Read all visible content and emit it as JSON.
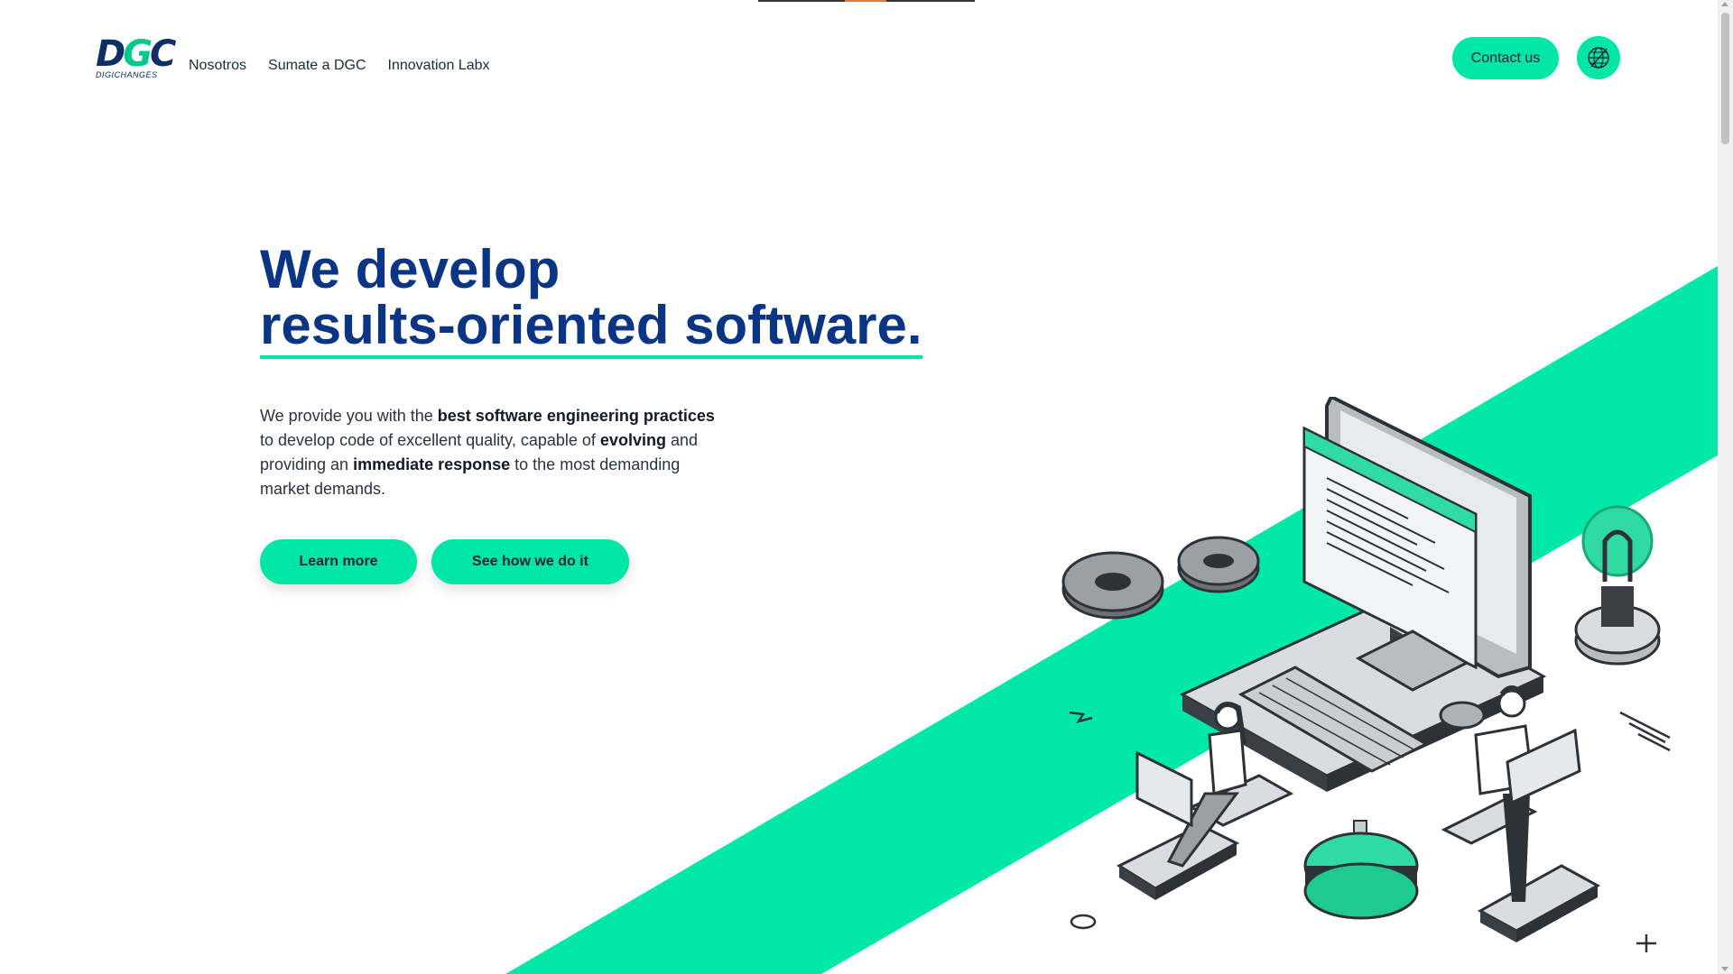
{
  "header": {
    "logo_text": "DGC",
    "logo_subtext": "DIGICHANGES",
    "nav": [
      "Nosotros",
      "Sumate a DGC",
      "Innovation Labx"
    ],
    "contact_label": "Contact us",
    "language_icon": "globe-icon"
  },
  "hero": {
    "title_line1": "We develop",
    "title_line2": "results-oriented software.",
    "desc": {
      "p1": "We provide you with the ",
      "b1": "best software engineering practices",
      "p2": " to develop code of excellent quality, capable of ",
      "b2": "evolving",
      "p3": " and providing an ",
      "b3": "immediate response",
      "p4": " to the most demanding market demands."
    },
    "learn_more_label": "Learn more",
    "see_how_label": "See how we do it"
  },
  "colors": {
    "accent": "#00e6a6",
    "title": "#0a3584",
    "text": "#2a3340"
  }
}
